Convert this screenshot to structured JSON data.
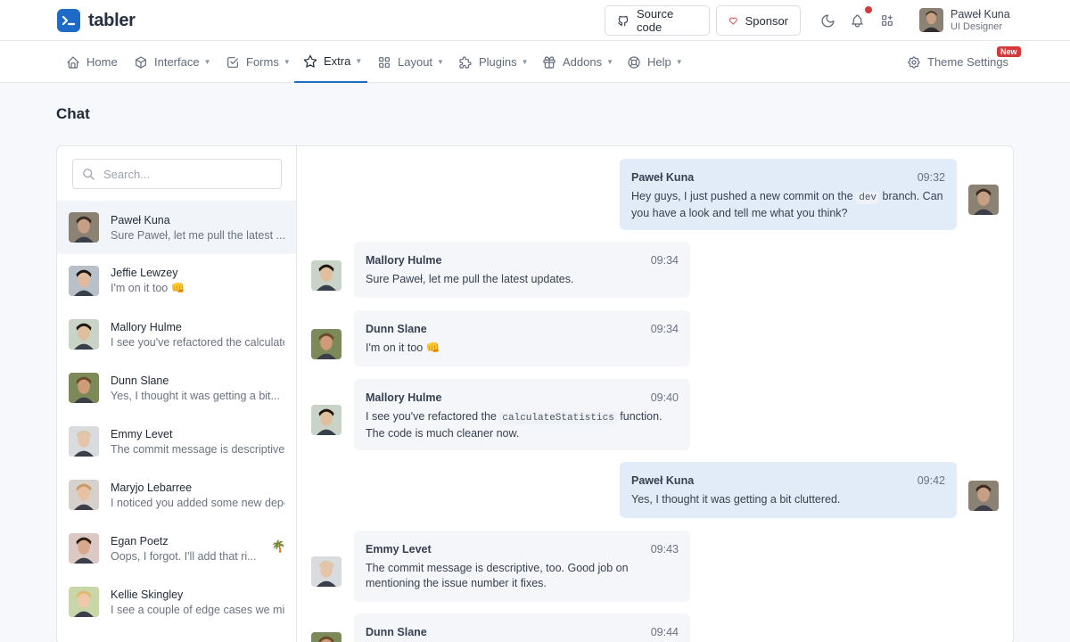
{
  "header": {
    "brand": "tabler",
    "source_code": "Source code",
    "sponsor": "Sponsor",
    "user_name": "Paweł Kuna",
    "user_role": "UI Designer"
  },
  "nav": {
    "items": [
      {
        "label": "Home"
      },
      {
        "label": "Interface"
      },
      {
        "label": "Forms"
      },
      {
        "label": "Extra"
      },
      {
        "label": "Layout"
      },
      {
        "label": "Plugins"
      },
      {
        "label": "Addons"
      },
      {
        "label": "Help"
      }
    ],
    "theme_settings": "Theme Settings",
    "new_badge": "New"
  },
  "page": {
    "title": "Chat"
  },
  "search": {
    "placeholder": "Search..."
  },
  "contacts": [
    {
      "name": "Paweł Kuna",
      "preview": "Sure Paweł, let me pull the latest ...",
      "skin": "#c79f84",
      "hair": "#3b2a1f",
      "bg": "#8c8274"
    },
    {
      "name": "Jeffie Lewzey",
      "preview": "I'm on it too 👊",
      "skin": "#e2b99c",
      "hair": "#1c1410",
      "bg": "#b8c0c9"
    },
    {
      "name": "Mallory Hulme",
      "preview": "I see you've refactored the calculateStatistics function.",
      "skin": "#e0bf9f",
      "hair": "#20160f",
      "bg": "#c9d3c7"
    },
    {
      "name": "Dunn Slane",
      "preview": "Yes, I thought it was getting a bit...",
      "skin": "#cf9b78",
      "hair": "#6b4a2b",
      "bg": "#7b8a58"
    },
    {
      "name": "Emmy Levet",
      "preview": "The commit message is descriptive, too. Good job",
      "skin": "#e6c4aa",
      "hair": "#d9c7a7",
      "bg": "#d8dcde"
    },
    {
      "name": "Maryjo Lebarree",
      "preview": "I noticed you added some new dependencies",
      "skin": "#e8c1a5",
      "hair": "#c89a64",
      "bg": "#d6d2cb"
    },
    {
      "name": "Egan Poetz",
      "preview": "Oops, I forgot. I'll add that ri...",
      "skin": "#d9a78a",
      "hair": "#2a1d14",
      "bg": "#dcc9c4"
    },
    {
      "name": "Kellie Skingley",
      "preview": "I see a couple of edge cases we might",
      "skin": "#edc9a9",
      "hair": "#e0b96f",
      "bg": "#c9d6a8"
    }
  ],
  "palm_icon": "🌴",
  "messages": [
    {
      "name": "Paweł Kuna",
      "time": "09:32",
      "parts": [
        "Hey guys, I just pushed a new commit on the ",
        "dev",
        " branch. Can you have a look and tell me what you think?"
      ]
    },
    {
      "name": "Mallory Hulme",
      "time": "09:34",
      "text": "Sure Paweł, let me pull the latest updates."
    },
    {
      "name": "Dunn Slane",
      "time": "09:34",
      "text": "I'm on it too 👊"
    },
    {
      "name": "Mallory Hulme",
      "time": "09:40",
      "parts": [
        "I see you've refactored the ",
        "calculateStatistics",
        " function. The code is much cleaner now."
      ]
    },
    {
      "name": "Paweł Kuna",
      "time": "09:42",
      "text": "Yes, I thought it was getting a bit cluttered."
    },
    {
      "name": "Emmy Levet",
      "time": "09:43",
      "text": "The commit message is descriptive, too. Good job on mentioning the issue number it fixes."
    },
    {
      "name": "Dunn Slane",
      "time": "09:44",
      "text": ""
    }
  ],
  "colors": {
    "primary": "#206bc4",
    "notification": "#d63939",
    "own_message": "#e2ebf8",
    "other_message": "#f4f6f9"
  }
}
